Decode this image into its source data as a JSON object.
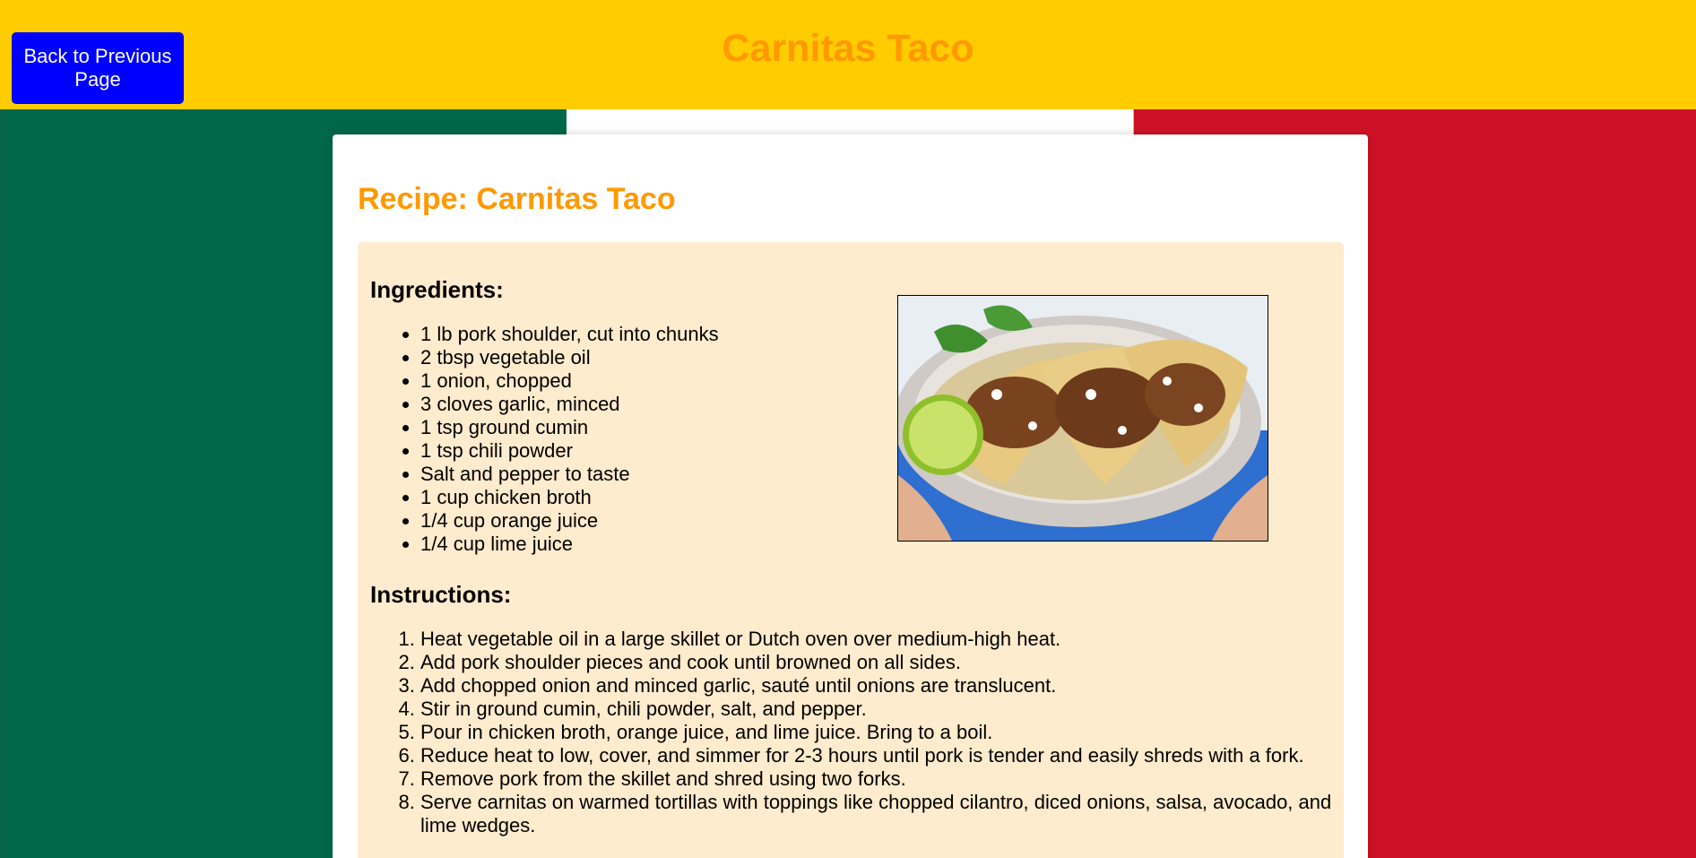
{
  "header": {
    "back_button_label": "Back to Previous Page",
    "title": "Carnitas Taco"
  },
  "recipe": {
    "title": "Recipe: Carnitas Taco",
    "ingredients_heading": "Ingredients:",
    "ingredients": [
      "1 lb pork shoulder, cut into chunks",
      "2 tbsp vegetable oil",
      "1 onion, chopped",
      "3 cloves garlic, minced",
      "1 tsp ground cumin",
      "1 tsp chili powder",
      "Salt and pepper to taste",
      "1 cup chicken broth",
      "1/4 cup orange juice",
      "1/4 cup lime juice"
    ],
    "instructions_heading": "Instructions:",
    "instructions": [
      "Heat vegetable oil in a large skillet or Dutch oven over medium-high heat.",
      "Add pork shoulder pieces and cook until browned on all sides.",
      "Add chopped onion and minced garlic, sauté until onions are translucent.",
      "Stir in ground cumin, chili powder, salt, and pepper.",
      "Pour in chicken broth, orange juice, and lime juice. Bring to a boil.",
      "Reduce heat to low, cover, and simmer for 2-3 hours until pork is tender and easily shreds with a fork.",
      "Remove pork from the skillet and shred using two forks.",
      "Serve carnitas on warmed tortillas with toppings like chopped cilantro, diced onions, salsa, avocado, and lime wedges."
    ]
  },
  "colors": {
    "header_bg": "#ffcc00",
    "title_color": "#ff9900",
    "button_bg": "#0000ff",
    "flag_green": "#006847",
    "flag_white": "#ffffff",
    "flag_red": "#ce1126",
    "recipe_box_bg": "#ffebcd"
  }
}
